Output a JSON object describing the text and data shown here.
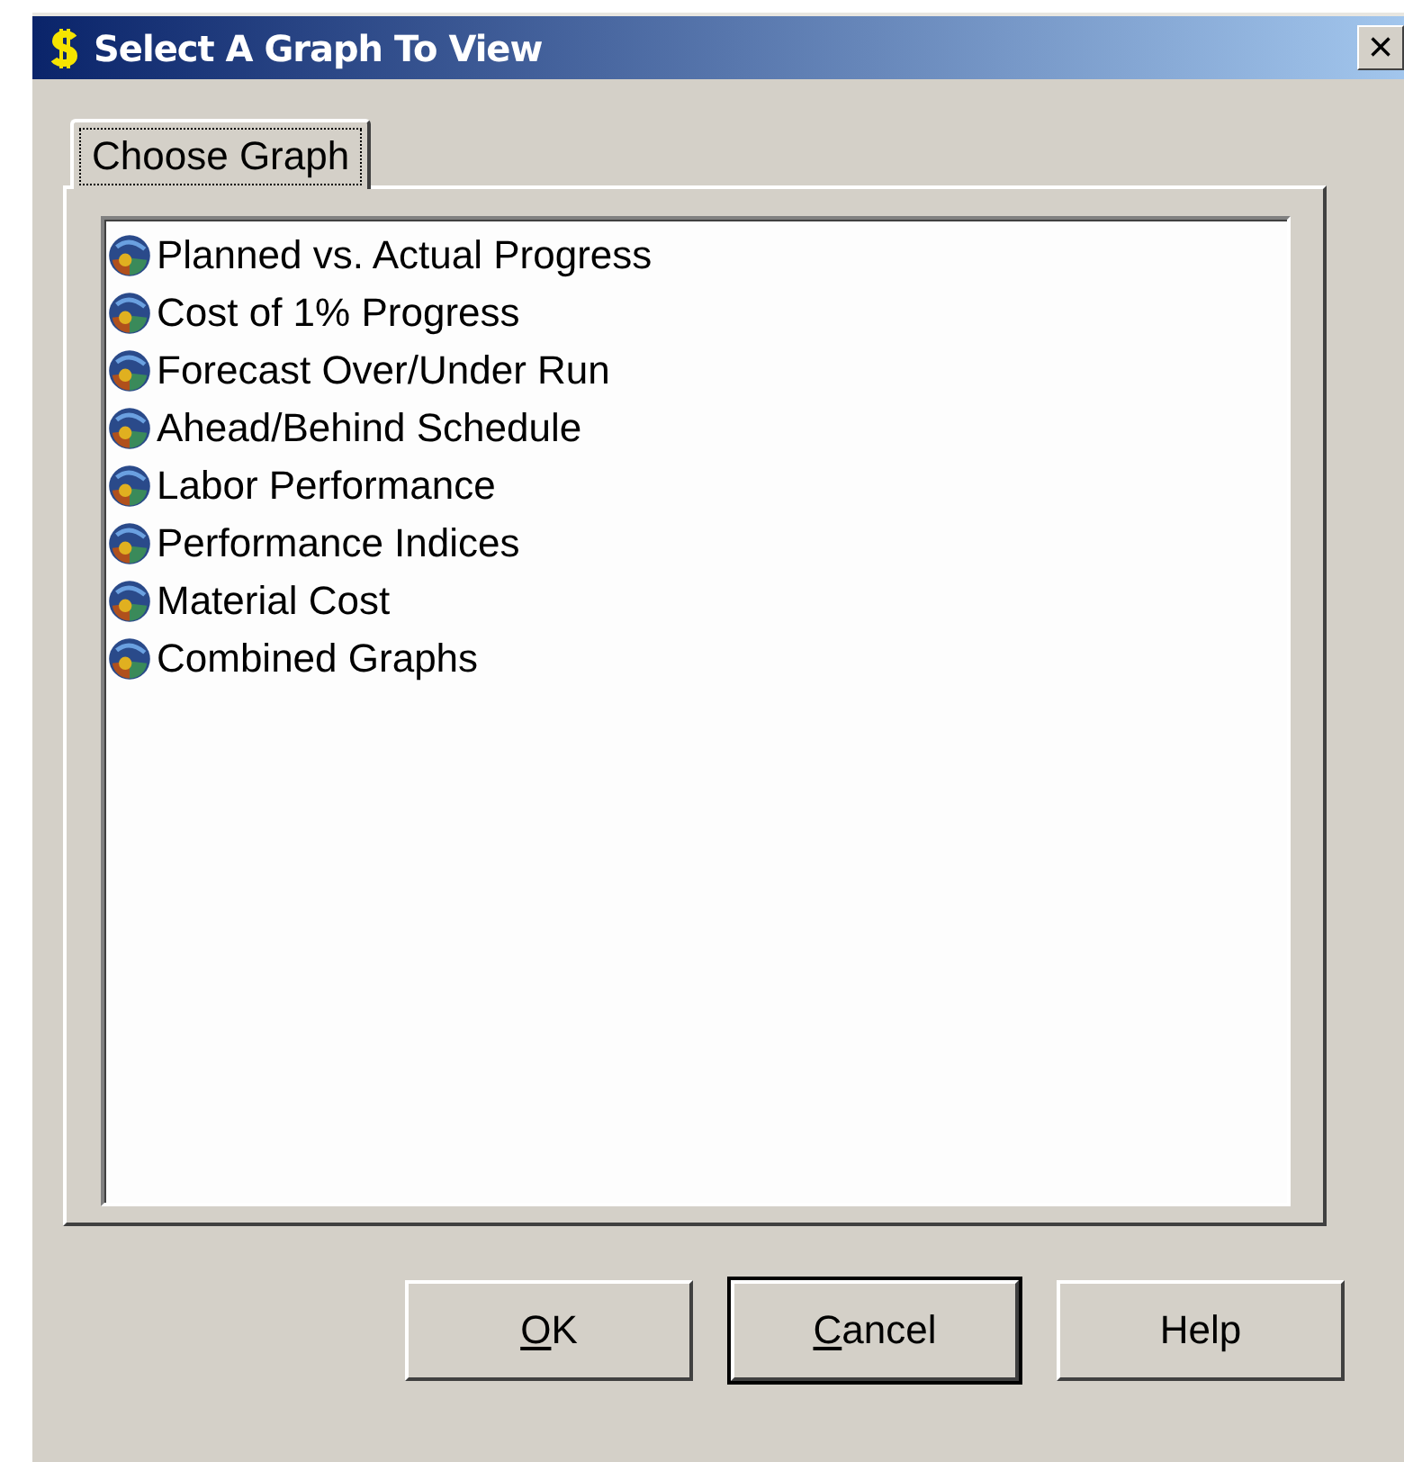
{
  "window": {
    "title": "Select A Graph To View",
    "close": "×"
  },
  "tabs": [
    {
      "label": "Choose Graph",
      "selected": true
    }
  ],
  "graphs": [
    {
      "label": "Planned vs. Actual Progress"
    },
    {
      "label": "Cost of 1% Progress"
    },
    {
      "label": "Forecast Over/Under Run"
    },
    {
      "label": "Ahead/Behind Schedule"
    },
    {
      "label": "Labor Performance"
    },
    {
      "label": "Performance Indices"
    },
    {
      "label": "Material Cost"
    },
    {
      "label": "Combined Graphs"
    }
  ],
  "buttons": [
    {
      "label": "OK",
      "underline_first": true,
      "default": false
    },
    {
      "label": "Cancel",
      "underline_first": true,
      "default": true
    },
    {
      "label": "Help",
      "underline_first": false,
      "default": false
    }
  ]
}
